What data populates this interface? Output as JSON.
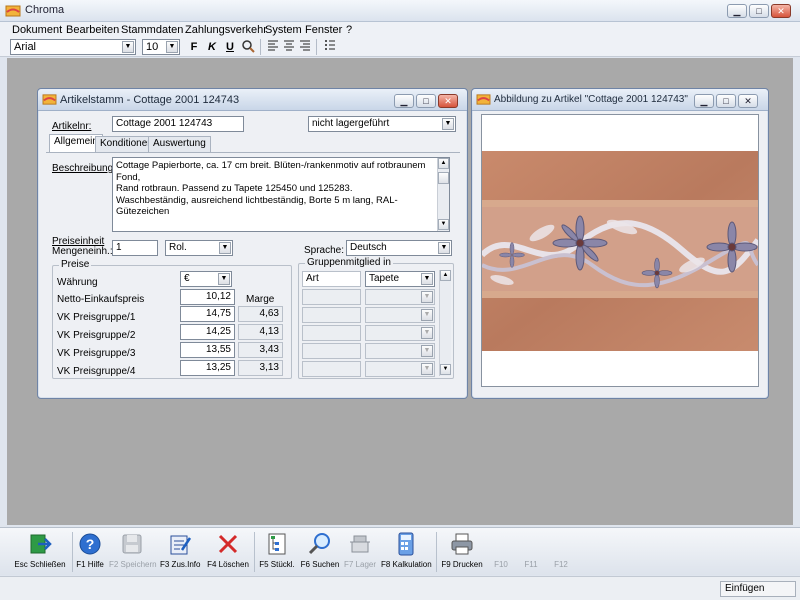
{
  "app": {
    "title": "Chroma"
  },
  "menu": [
    "Dokument",
    "Bearbeiten",
    "Stammdaten",
    "Zahlungsverkehr",
    "System",
    "Fenster",
    "?"
  ],
  "toolbar": {
    "font": "Arial",
    "size": "10",
    "bold": "F",
    "italic": "K",
    "underline": "U"
  },
  "article_window": {
    "title": "Artikelstamm - Cottage 2001 124743",
    "artikelnr_label": "Artikelnr:",
    "artikelnr_value": "Cottage 2001 124743",
    "lager_select": "nicht lagergeführt",
    "tabs": [
      "Allgemein",
      "Konditionen",
      "Auswertung"
    ],
    "beschreibung_label": "Beschreibung:",
    "beschreibung_lines": [
      "Cottage Papierborte, ca. 17 cm breit. Blüten-/rankenmotiv auf rotbraunem Fond,",
      "Rand rotbraun. Passend zu Tapete 125450 und 125283.",
      "Waschbeständig, ausreichend lichtbeständig, Borte 5 m lang, RAL-Gütezeichen"
    ],
    "preiseinheit_label1": "Preiseinheit",
    "preiseinheit_label2": "Mengeneinh.:",
    "preiseinheit_value": "1",
    "mengeneinheit_value": "Rol.",
    "sprache_label": "Sprache:",
    "sprache_value": "Deutsch",
    "preise": {
      "legend": "Preise",
      "waehrung_label": "Währung",
      "waehrung_value": "€",
      "marge_header": "Marge",
      "rows": [
        {
          "label": "Netto-Einkaufspreis",
          "price": "10,12",
          "marge": ""
        },
        {
          "label": "VK Preisgruppe/1",
          "price": "14,75",
          "marge": "4,63"
        },
        {
          "label": "VK Preisgruppe/2",
          "price": "14,25",
          "marge": "4,13"
        },
        {
          "label": "VK Preisgruppe/3",
          "price": "13,55",
          "marge": "3,43"
        },
        {
          "label": "VK Preisgruppe/4",
          "price": "13,25",
          "marge": "3,13"
        }
      ]
    },
    "gruppen": {
      "legend": "Gruppenmitglied in",
      "col_art": "Art",
      "first_value": "Tapete"
    }
  },
  "image_window": {
    "title": "Abbildung zu Artikel \"Cottage 2001 124743\""
  },
  "fkeys": [
    {
      "label": "Esc Schließen",
      "icon": "exit-icon",
      "enabled": true
    },
    {
      "label": "F1 Hilfe",
      "icon": "help-icon",
      "enabled": true
    },
    {
      "label": "F2 Speichern",
      "icon": "save-icon",
      "enabled": false
    },
    {
      "label": "F3 Zus.Info",
      "icon": "info-edit-icon",
      "enabled": true
    },
    {
      "label": "F4 Löschen",
      "icon": "delete-icon",
      "enabled": true
    },
    {
      "label": "F5 Stückl.",
      "icon": "tree-icon",
      "enabled": true
    },
    {
      "label": "F6 Suchen",
      "icon": "search-icon",
      "enabled": true
    },
    {
      "label": "F7 Lager",
      "icon": "warehouse-icon",
      "enabled": false
    },
    {
      "label": "F8 Kalkulation",
      "icon": "calculator-icon",
      "enabled": true
    },
    {
      "label": "F9 Drucken",
      "icon": "printer-icon",
      "enabled": true
    },
    {
      "label": "F10",
      "icon": "",
      "enabled": false
    },
    {
      "label": "F11",
      "icon": "",
      "enabled": false
    },
    {
      "label": "F12",
      "icon": "",
      "enabled": false
    }
  ],
  "status": {
    "mode": "Einfügen"
  }
}
